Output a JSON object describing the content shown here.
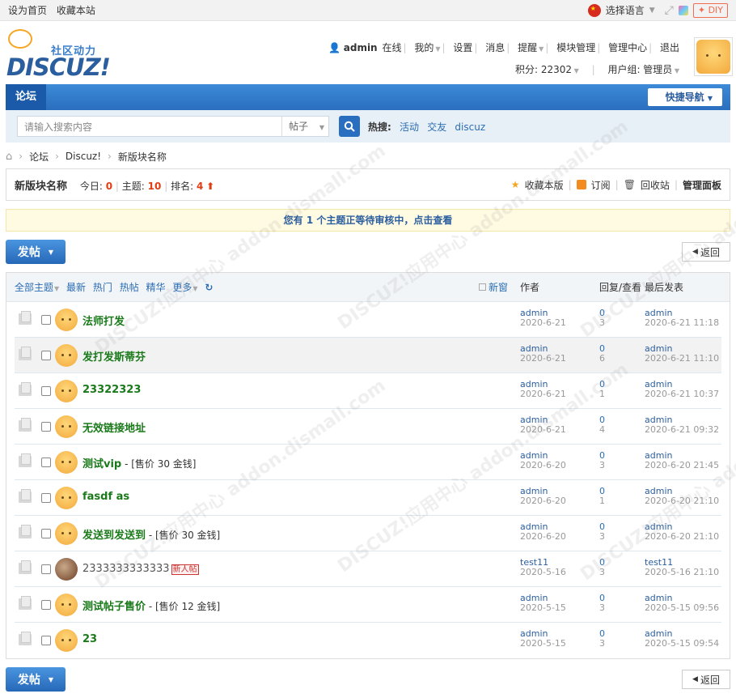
{
  "topbar": {
    "set_home": "设为首页",
    "bookmark": "收藏本站",
    "language": "选择语言",
    "diy": "DIY"
  },
  "logo": {
    "cn": "社区动力",
    "en": "DISCUZ!"
  },
  "user": {
    "name": "admin",
    "status": "在线",
    "mine": "我的",
    "settings": "设置",
    "messages": "消息",
    "remind": "提醒",
    "block_mgmt": "模块管理",
    "admin_center": "管理中心",
    "logout": "退出",
    "points": "积分: 22302",
    "group": "用户组: 管理员"
  },
  "nav": {
    "tab": "论坛",
    "quick": "快捷导航"
  },
  "search": {
    "placeholder": "请输入搜索内容",
    "type": "帖子",
    "hot_label": "热搜:",
    "hot": [
      "活动",
      "交友",
      "discuz"
    ]
  },
  "breadcrumb": [
    "论坛",
    "Discuz!",
    "新版块名称"
  ],
  "forum": {
    "name": "新版块名称",
    "today_label": "今日:",
    "today": "0",
    "threads_label": "主题:",
    "threads": "10",
    "rank_label": "排名:",
    "rank": "4",
    "fav": "收藏本版",
    "subscribe": "订阅",
    "recycle": "回收站",
    "manage": "管理面板"
  },
  "notice": "您有 1 个主题正等待审核中，点击查看",
  "buttons": {
    "post": "发帖",
    "back": "返回"
  },
  "list_header": {
    "filters": [
      "全部主题",
      "最新",
      "热门",
      "热帖",
      "精华",
      "更多"
    ],
    "new_window": "新窗",
    "author": "作者",
    "replies": "回复/查看",
    "last": "最后发表"
  },
  "threads": [
    {
      "title": "法师打发",
      "price": "",
      "author": "admin",
      "date": "2020-6-21",
      "replies": "0",
      "views": "3",
      "last_user": "admin",
      "last_time": "2020-6-21 11:18"
    },
    {
      "title": "发打发斯蒂芬",
      "price": "",
      "author": "admin",
      "date": "2020-6-21",
      "replies": "0",
      "views": "6",
      "last_user": "admin",
      "last_time": "2020-6-21 11:10"
    },
    {
      "title": "23322323",
      "price": "",
      "author": "admin",
      "date": "2020-6-21",
      "replies": "0",
      "views": "1",
      "last_user": "admin",
      "last_time": "2020-6-21 10:37"
    },
    {
      "title": "无效链接地址",
      "price": "",
      "author": "admin",
      "date": "2020-6-21",
      "replies": "0",
      "views": "4",
      "last_user": "admin",
      "last_time": "2020-6-21 09:32"
    },
    {
      "title": "测试vip",
      "price": " - [售价 30 金钱]",
      "author": "admin",
      "date": "2020-6-20",
      "replies": "0",
      "views": "3",
      "last_user": "admin",
      "last_time": "2020-6-20 21:45"
    },
    {
      "title": "fasdf as",
      "price": "",
      "author": "admin",
      "date": "2020-6-20",
      "replies": "0",
      "views": "1",
      "last_user": "admin",
      "last_time": "2020-6-20 21:10"
    },
    {
      "title": "发送到发送到",
      "price": " - [售价 30 金钱]",
      "author": "admin",
      "date": "2020-6-20",
      "replies": "0",
      "views": "3",
      "last_user": "admin",
      "last_time": "2020-6-20 21:10"
    },
    {
      "title": "2333333333333",
      "price": "",
      "badge": "新人帖",
      "author": "test11",
      "date": "2020-5-16",
      "replies": "0",
      "views": "3",
      "last_user": "test11",
      "last_time": "2020-5-16 21:10"
    },
    {
      "title": "测试帖子售价",
      "price": " - [售价 12 金钱]",
      "author": "admin",
      "date": "2020-5-15",
      "replies": "0",
      "views": "3",
      "last_user": "admin",
      "last_time": "2020-5-15 09:56"
    },
    {
      "title": "23",
      "price": "",
      "author": "admin",
      "date": "2020-5-15",
      "replies": "0",
      "views": "3",
      "last_user": "admin",
      "last_time": "2020-5-15 09:54"
    }
  ],
  "watermark": "DISCUZ!应用中心 addon.dismall.com"
}
